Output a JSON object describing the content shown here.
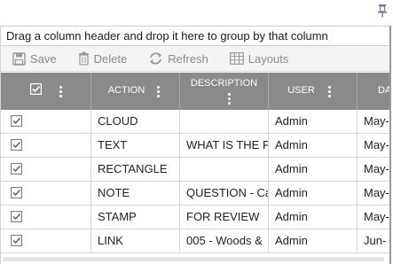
{
  "pin": {
    "icon": "pin-icon"
  },
  "group_panel": {
    "text": "Drag a column header and drop it here to group by that column"
  },
  "toolbar": {
    "buttons": [
      {
        "label": "Save",
        "icon": "save-icon"
      },
      {
        "label": "Delete",
        "icon": "trash-icon"
      },
      {
        "label": "Refresh",
        "icon": "refresh-icon"
      },
      {
        "label": "Layouts",
        "icon": "grid-layout-icon"
      }
    ]
  },
  "grid": {
    "header_bg": "#8a8a8a",
    "columns": [
      {
        "label": ""
      },
      {
        "label": "ACTION"
      },
      {
        "label": "DESCRIPTION"
      },
      {
        "label": "USER"
      },
      {
        "label": "DA"
      }
    ],
    "rows": [
      {
        "action": "CLOUD",
        "description": "",
        "user": "Admin",
        "date": "May-"
      },
      {
        "action": "TEXT",
        "description": "WHAT IS THE PA",
        "user": "Admin",
        "date": "May-"
      },
      {
        "action": "RECTANGLE",
        "description": "",
        "user": "Admin",
        "date": "May-"
      },
      {
        "action": "NOTE",
        "description": "QUESTION - Ca",
        "user": "Admin",
        "date": "May-"
      },
      {
        "action": "STAMP",
        "description": "FOR REVIEW",
        "user": "Admin",
        "date": "May-"
      },
      {
        "action": "LINK",
        "description": "005 - Woods &",
        "user": "Admin",
        "date": "Jun-"
      }
    ]
  }
}
